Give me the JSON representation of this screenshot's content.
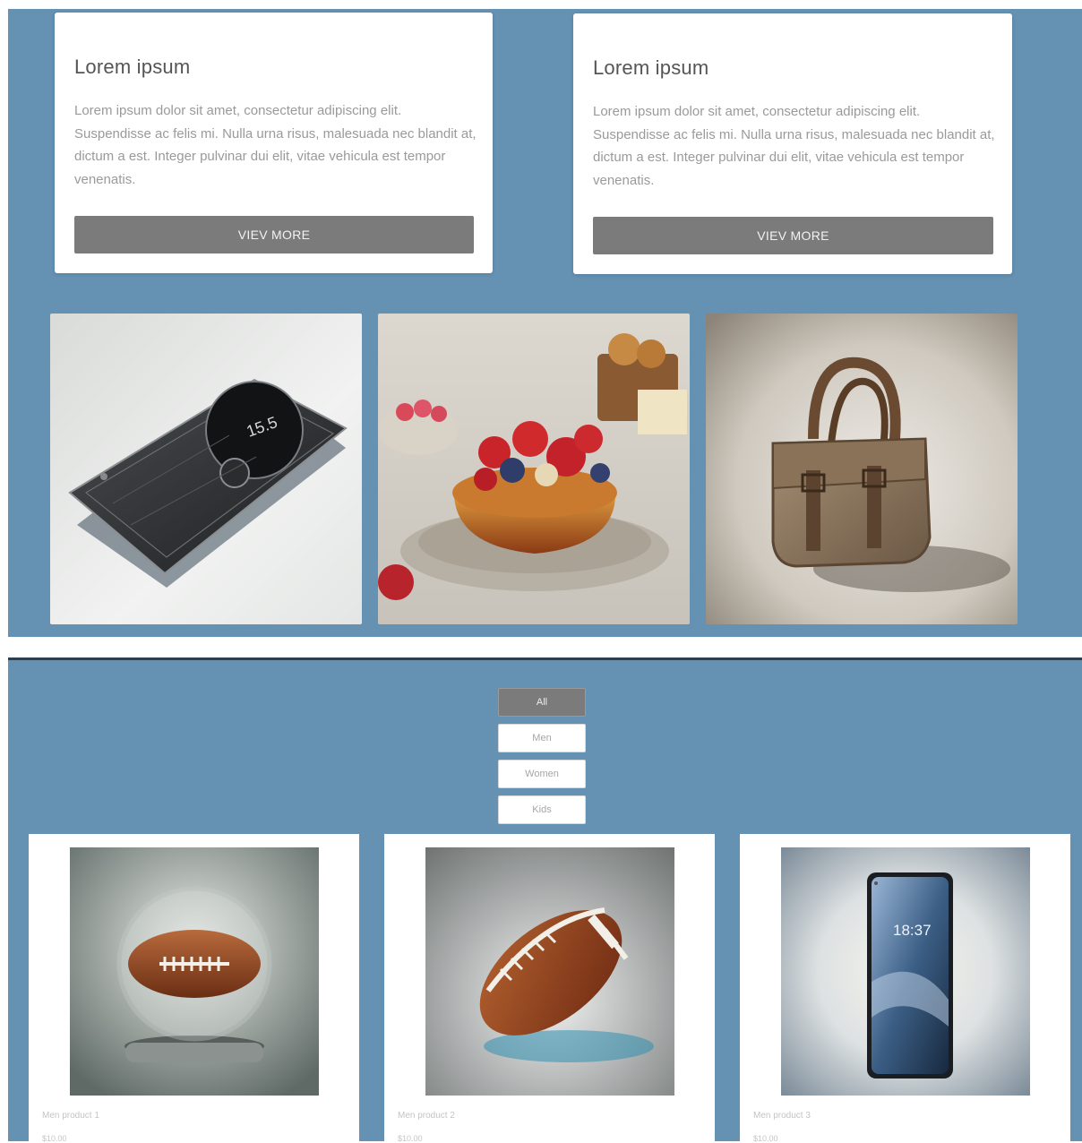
{
  "cards": [
    {
      "title": "Lorem ipsum",
      "body": "Lorem ipsum dolor sit amet, consectetur adipiscing elit. Suspendisse ac felis mi. Nulla urna risus, malesuada nec blandit at, dictum a est. Integer pulvinar dui elit, vitae vehicula est tempor venenatis.",
      "button": "VIEV MORE"
    },
    {
      "title": "Lorem ipsum",
      "body": "Lorem ipsum dolor sit amet, consectetur adipiscing elit. Suspendisse ac felis mi. Nulla urna risus, malesuada nec blandit at, dictum a est. Integer pulvinar dui elit, vitae vehicula est tempor venenatis.",
      "button": "VIEV MORE"
    }
  ],
  "gallery": [
    {
      "icon": "phone-device-image",
      "display_text": "15.5"
    },
    {
      "icon": "berry-cake-image"
    },
    {
      "icon": "handbag-image"
    }
  ],
  "filters": [
    {
      "label": "All",
      "active": true
    },
    {
      "label": "Men",
      "active": false
    },
    {
      "label": "Women",
      "active": false
    },
    {
      "label": "Kids",
      "active": false
    }
  ],
  "products": [
    {
      "name": "Men product 1",
      "price": "$10.00",
      "icon": "football-globe-image"
    },
    {
      "name": "Men product 2",
      "price": "$10.00",
      "icon": "football-image"
    },
    {
      "name": "Men product 3",
      "price": "$10.00",
      "icon": "smartphone-image",
      "screen_time": "18:37"
    }
  ],
  "colors": {
    "section_bg": "#6591b3",
    "button_bg": "#7b7b7b",
    "card_bg": "#ffffff"
  }
}
